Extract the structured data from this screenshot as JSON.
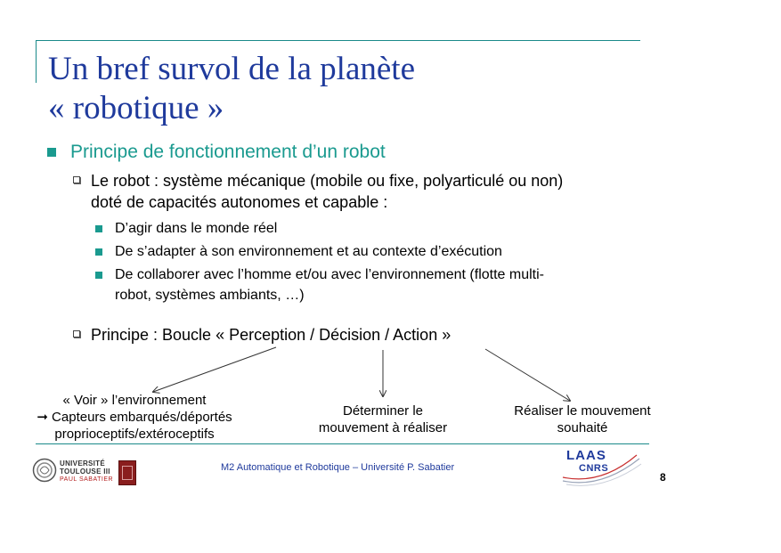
{
  "slide": {
    "title_line1": "Un bref survol de la planète",
    "title_line2": "« robotique »",
    "bullet_main": "Principe de fonctionnement d’un robot",
    "sub_bullet1_line1": "Le robot : système mécanique (mobile ou fixe, polyarticulé ou non)",
    "sub_bullet1_line2": "doté de capacités autonomes et capable :",
    "items": [
      "D’agir dans le monde réel",
      "De s’adapter à son environnement et au contexte d’exécution",
      "De collaborer avec l’homme et/ou avec l’environnement (flotte multi-",
      "robot, systèmes ambiants, …)"
    ],
    "sub_bullet2": "Principe : Boucle « Perception / Décision / Action »"
  },
  "diagram": {
    "perception_line1": "« Voir » l’environnement",
    "perception_line2": "➞ Capteurs embarqués/déportés",
    "perception_line3": "proprioceptifs/extéroceptifs",
    "decision_line1": "Déterminer le",
    "decision_line2": "mouvement à réaliser",
    "action_line1": "Réaliser le mouvement",
    "action_line2": "souhaité"
  },
  "footer": {
    "text": "M2 Automatique et Robotique  –  Université P. Sabatier",
    "page": "8",
    "ut_logo_line1": "UNIVERSITÉ",
    "ut_logo_line2": "TOULOUSE III",
    "ut_logo_line3": "PAUL SABATIER",
    "laas": "LAAS",
    "cnrs": "CNRS"
  },
  "colors": {
    "title": "#1f3a9c",
    "accent": "#1a9a8f",
    "rule": "#1a8a8a"
  }
}
